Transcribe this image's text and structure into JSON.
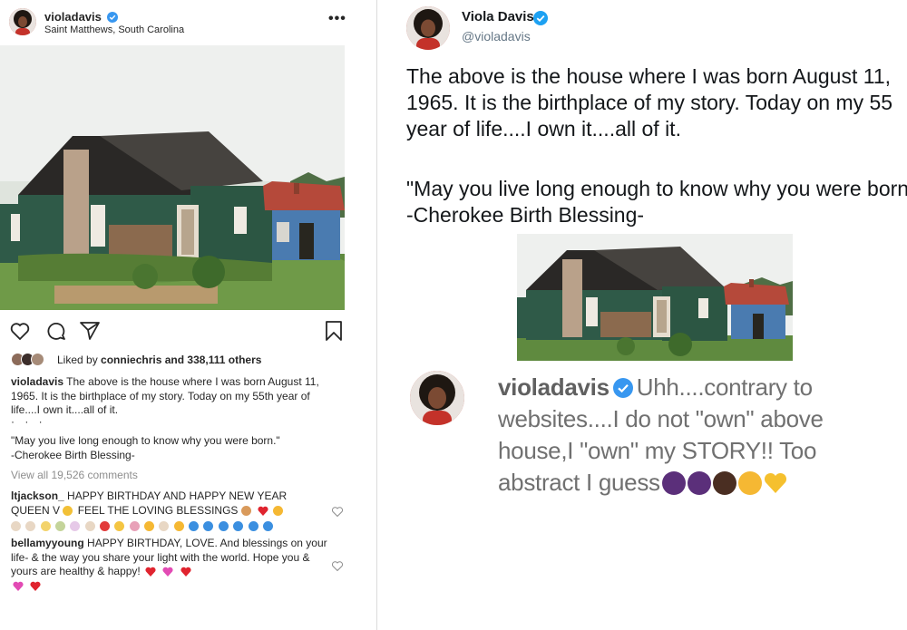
{
  "instagram_post": {
    "username": "violadavis",
    "location": "Saint Matthews, South Carolina",
    "more_icon": "ellipsis-icon",
    "more_label": "•••",
    "actions": [
      "heart-icon",
      "comment-icon",
      "share-icon",
      "bookmark-icon"
    ],
    "likes": {
      "prefix": "Liked by ",
      "liker": "conniechris",
      "suffix": " and 338,111 others"
    },
    "caption_text": "The above is the house where I was born August 11, 1965. It is the birthplace of my story. Today on my 55th year of life....I own it....all of it.",
    "caption_dots": "· · ·",
    "quote_line1": "\"May you live long enough to know why you were born.\"",
    "quote_line2": "-Cherokee Birth Blessing-",
    "view_all": "View all 19,526 comments",
    "comments": [
      {
        "username": "ltjackson_",
        "text_a": "HAPPY BIRTHDAY AND HAPPY NEW YEAR QUEEN V",
        "text_b": "FEEL THE LOVING BLESSINGS"
      },
      {
        "username": "bellamyyoung",
        "text": "HAPPY BIRTHDAY, LOVE. And blessings on your life- & the way you share your light with the world. Hope you & yours are healthy & happy!"
      }
    ]
  },
  "tweet": {
    "name": "Viola Davis",
    "handle": "@violadavis",
    "line1": "The above is the house where I was born August 11,",
    "line2": "1965. It is the birthplace of my story. Today on my 55",
    "line3": "year of life....I own it....all of it.",
    "quote1": "\"May you live long enough to know why you were born",
    "quote2": "-Cherokee Birth Blessing-"
  },
  "reply_comment": {
    "username": "violadavis",
    "text": "Uhh....contrary to websites....I do not \"own\" above house,I \"own\" my STORY!! Too abstract I guess"
  },
  "colors": {
    "verified_blue": "#3897f0",
    "twitter_blue": "#1da1f2",
    "heart_red": "#ed4956",
    "house_green": "#2e5a45",
    "roof_red": "#b5493a"
  }
}
